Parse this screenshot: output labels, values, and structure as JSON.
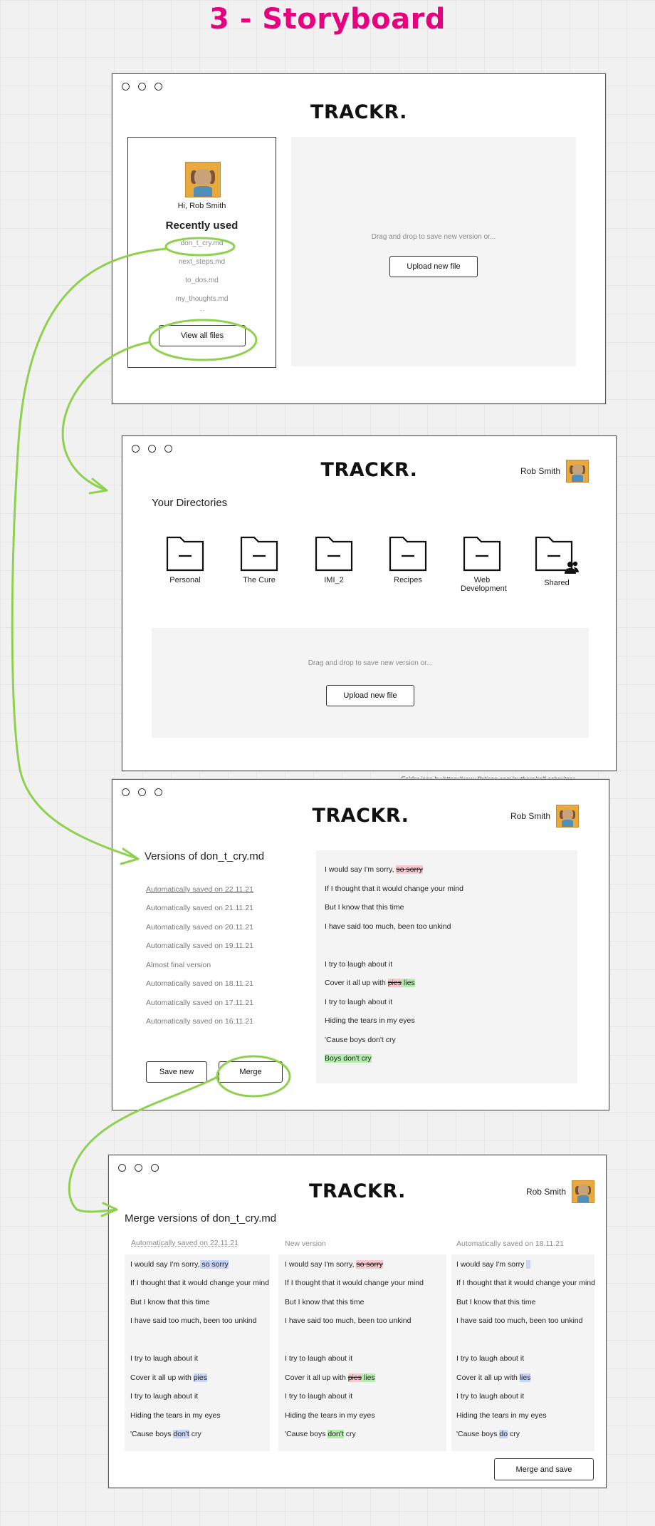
{
  "title": "3 - Storyboard",
  "brand": "TRACKR.",
  "user_name": "Rob Smith",
  "colors": {
    "accent": "#e6007e",
    "annotation": "#8fd14f",
    "removed": "#f7c9cf",
    "added": "#b6ecb0",
    "changed": "#c9d5f8"
  },
  "icons": {
    "avatar": "dog-avatar-icon",
    "folder": "folder-icon",
    "shared": "people-icon"
  },
  "screen1": {
    "greeting": "Hi, Rob Smith",
    "recently_used_title": "Recently used",
    "recent_files": [
      "don_t_cry.md",
      "next_steps.md",
      "to_dos.md",
      "my_thoughts.md"
    ],
    "more": "...",
    "view_all_button": "View all files",
    "drop_hint": "Drag and drop to save new version or...",
    "upload_button": "Upload new file"
  },
  "screen2": {
    "section_title": "Your Directories",
    "folders": [
      "Personal",
      "The Cure",
      "IMI_2",
      "Recipes",
      "Web Development",
      "Shared"
    ],
    "drop_hint": "Drag and drop to save new version or...",
    "upload_button": "Upload new file",
    "credit": "Folder icon by https://www.flaticon.com/authors/ralf-schmitzer"
  },
  "screen3": {
    "title": "Versions of don_t_cry.md",
    "versions": [
      "Automatically saved on 22.11.21",
      "Automatically saved on 21.11.21",
      "Automatically saved on 20.11.21",
      "Automatically saved on 19.11.21",
      "Almost final version",
      "Automatically saved on 18.11.21",
      "Automatically saved on 17.11.21",
      "Automatically saved on 16.11.21"
    ],
    "save_new_button": "Save new",
    "merge_button": "Merge",
    "lyrics": {
      "l1a": "I would say I'm sorry,",
      "l1b": "so sorry",
      "l2": "If I thought that it would change your mind",
      "l3": "But I know that this time",
      "l4": "I have said too much, been too unkind",
      "l5": "I try to laugh about it",
      "l6a": "Cover it all up with",
      "l6b": "pies",
      "l6c": "lies",
      "l7": "I try to laugh about it",
      "l8": "Hiding the tears in my eyes",
      "l9": "'Cause boys don't cry",
      "l10": "Boys don't cry"
    }
  },
  "screen4": {
    "title": "Merge versions of don_t_cry.md",
    "col1_title": "Automatically saved on 22.11.21",
    "col2_title": "New version",
    "col3_title": "Automatically saved on 18.11.21",
    "merge_save_button": "Merge and save",
    "common": {
      "l1": "I would say I'm sorry,",
      "l1_plain": "I would say I'm sorry",
      "sorry": "so sorry",
      "l2": "If I thought that it would change your mind",
      "l3": "But I know that this time",
      "l4": "I have said too much, been too unkind",
      "l5": "I try to laugh about it",
      "l6": "Cover it all up with",
      "pies": "pies",
      "lies": "lies",
      "l7": "I try to laugh about it",
      "l8": "Hiding the tears in my eyes",
      "l9a": "'Cause boys",
      "dont": "don't",
      "do": "do",
      "l9b": "cry"
    }
  }
}
